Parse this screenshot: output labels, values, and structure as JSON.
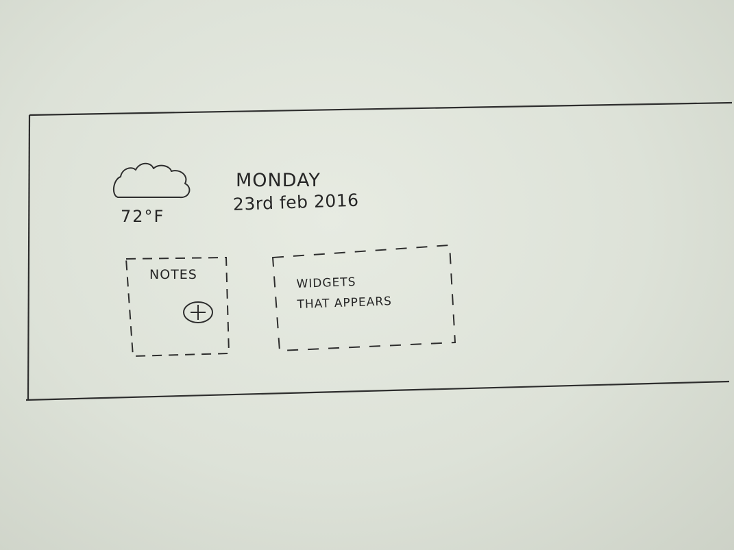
{
  "weather": {
    "icon": "cloud-icon",
    "temperature": "72°F"
  },
  "date_block": {
    "day": "MONDAY",
    "date": "23rd feb 2016"
  },
  "notes_widget": {
    "title": "NOTES",
    "add_icon": "plus-circle-icon"
  },
  "widgets_area": {
    "text": "WIDGETS\nTHAT APPEARS"
  },
  "colors": {
    "ink": "#262626",
    "paper": "#e2e6dd"
  }
}
